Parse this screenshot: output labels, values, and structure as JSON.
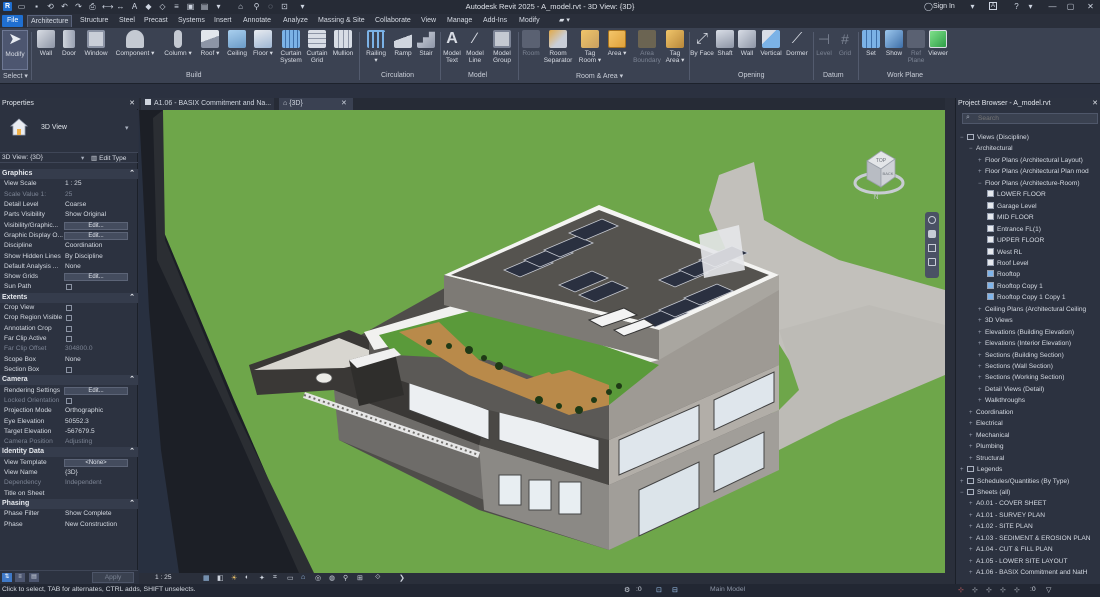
{
  "title_bar": {
    "title": "Autodesk Revit 2025 - A_model.rvt - 3D View: {3D}",
    "sign_in": "Sign In"
  },
  "ribbon_tabs": [
    "File",
    "Architecture",
    "Structure",
    "Steel",
    "Precast",
    "Systems",
    "Insert",
    "Annotate",
    "Analyze",
    "Massing & Site",
    "Collaborate",
    "View",
    "Manage",
    "Add-Ins",
    "Modify"
  ],
  "ribbon": {
    "buttons": [
      {
        "id": "modify",
        "label": "Modify"
      },
      {
        "id": "wall",
        "label": "Wall"
      },
      {
        "id": "door",
        "label": "Door"
      },
      {
        "id": "window",
        "label": "Window"
      },
      {
        "id": "component",
        "label": "Component"
      },
      {
        "id": "column",
        "label": "Column"
      },
      {
        "id": "roof",
        "label": "Roof"
      },
      {
        "id": "ceiling",
        "label": "Ceiling"
      },
      {
        "id": "floor",
        "label": "Floor"
      },
      {
        "id": "curtain-system",
        "label": "Curtain System"
      },
      {
        "id": "curtain-grid",
        "label": "Curtain Grid"
      },
      {
        "id": "mullion",
        "label": "Mullion"
      },
      {
        "id": "railing",
        "label": "Railing"
      },
      {
        "id": "ramp",
        "label": "Ramp"
      },
      {
        "id": "stair",
        "label": "Stair"
      },
      {
        "id": "model-text",
        "label": "Model Text"
      },
      {
        "id": "model-line",
        "label": "Model Line"
      },
      {
        "id": "model-group",
        "label": "Model Group"
      },
      {
        "id": "room",
        "label": "Room"
      },
      {
        "id": "room-separator",
        "label": "Room Separator"
      },
      {
        "id": "tag-room",
        "label": "Tag Room"
      },
      {
        "id": "area",
        "label": "Area"
      },
      {
        "id": "area-boundary",
        "label": "Area Boundary"
      },
      {
        "id": "tag-area",
        "label": "Tag Area"
      },
      {
        "id": "by-face",
        "label": "By Face"
      },
      {
        "id": "shaft",
        "label": "Shaft"
      },
      {
        "id": "opening-wall",
        "label": "Wall"
      },
      {
        "id": "vertical",
        "label": "Vertical"
      },
      {
        "id": "dormer",
        "label": "Dormer"
      },
      {
        "id": "level",
        "label": "Level"
      },
      {
        "id": "grid",
        "label": "Grid"
      },
      {
        "id": "set",
        "label": "Set"
      },
      {
        "id": "show",
        "label": "Show"
      },
      {
        "id": "ref-plane",
        "label": "Ref Plane"
      },
      {
        "id": "viewer",
        "label": "Viewer"
      }
    ],
    "groups": [
      "Select",
      "Build",
      "Circulation",
      "Model",
      "Room & Area",
      "Opening",
      "Datum",
      "Work Plane"
    ]
  },
  "properties": {
    "header": "Properties",
    "type_name": "3D View",
    "selector": "3D View: {3D}",
    "edit_type": "Edit Type",
    "sections": [
      {
        "name": "Graphics",
        "rows": [
          {
            "k": "View Scale",
            "v": "1 : 25"
          },
          {
            "k": "Scale Value 1:",
            "v": "25",
            "dim": true
          },
          {
            "k": "Detail Level",
            "v": "Coarse"
          },
          {
            "k": "Parts Visibility",
            "v": "Show Original"
          },
          {
            "k": "Visibility/Graphic...",
            "btn": "Edit..."
          },
          {
            "k": "Graphic Display O...",
            "btn": "Edit..."
          },
          {
            "k": "Discipline",
            "v": "Coordination"
          },
          {
            "k": "Show Hidden Lines",
            "v": "By Discipline"
          },
          {
            "k": "Default Analysis ...",
            "v": "None"
          },
          {
            "k": "Show Grids",
            "btn": "Edit..."
          },
          {
            "k": "Sun Path",
            "chk": true
          }
        ]
      },
      {
        "name": "Extents",
        "rows": [
          {
            "k": "Crop View",
            "chk": true
          },
          {
            "k": "Crop Region Visible",
            "chk": true
          },
          {
            "k": "Annotation Crop",
            "chk": true
          },
          {
            "k": "Far Clip Active",
            "chk": true
          },
          {
            "k": "Far Clip Offset",
            "v": "304800.0",
            "dim": true
          },
          {
            "k": "Scope Box",
            "v": "None"
          },
          {
            "k": "Section Box",
            "chk": true
          }
        ]
      },
      {
        "name": "Camera",
        "rows": [
          {
            "k": "Rendering Settings",
            "btn": "Edit..."
          },
          {
            "k": "Locked Orientation",
            "chk": true,
            "dim": true
          },
          {
            "k": "Projection Mode",
            "v": "Orthographic"
          },
          {
            "k": "Eye Elevation",
            "v": "50552.3"
          },
          {
            "k": "Target Elevation",
            "v": "-567679.5"
          },
          {
            "k": "Camera Position",
            "v": "Adjusting",
            "dim": true
          }
        ]
      },
      {
        "name": "Identity Data",
        "rows": [
          {
            "k": "View Template",
            "btn": "<None>"
          },
          {
            "k": "View Name",
            "v": "{3D}"
          },
          {
            "k": "Dependency",
            "v": "Independent",
            "dim": true
          },
          {
            "k": "Title on Sheet",
            "v": ""
          }
        ]
      },
      {
        "name": "Phasing",
        "rows": [
          {
            "k": "Phase Filter",
            "v": "Show Complete"
          },
          {
            "k": "Phase",
            "v": "New Construction"
          }
        ]
      }
    ],
    "apply": "Apply"
  },
  "view_tabs": [
    {
      "label": "A1.06 - BASIX Commitment and Na..."
    },
    {
      "label": "{3D}"
    }
  ],
  "project_browser": {
    "header": "Project Browser - A_model.rvt",
    "search_placeholder": "Search",
    "items": [
      {
        "label": "Views (Discipline)",
        "indent": 0,
        "tw": "−"
      },
      {
        "label": "Architectural",
        "indent": 1,
        "tw": "−"
      },
      {
        "label": "Floor Plans (Architectural Layout)",
        "indent": 2,
        "tw": "+"
      },
      {
        "label": "Floor Plans (Architectural Plan mod",
        "indent": 2,
        "tw": "+"
      },
      {
        "label": "Floor Plans (Architecture-Room)",
        "indent": 2,
        "tw": "−"
      },
      {
        "label": "LOWER FLOOR",
        "indent": 3,
        "view": true
      },
      {
        "label": "Garage Level",
        "indent": 3,
        "view": true
      },
      {
        "label": "MID FLOOR",
        "indent": 3,
        "view": true
      },
      {
        "label": "Entrance FL(1)",
        "indent": 3,
        "view": true
      },
      {
        "label": "UPPER FLOOR",
        "indent": 3,
        "view": true
      },
      {
        "label": "West RL",
        "indent": 3,
        "view": true
      },
      {
        "label": "Roof Level",
        "indent": 3,
        "view": true
      },
      {
        "label": "Rooftop",
        "indent": 3,
        "view": true,
        "blue": true
      },
      {
        "label": "Rooftop Copy 1",
        "indent": 3,
        "view": true,
        "blue": true
      },
      {
        "label": "Rooftop Copy 1 Copy 1",
        "indent": 3,
        "view": true,
        "blue": true
      },
      {
        "label": "Ceiling Plans (Architectural Ceiling",
        "indent": 2,
        "tw": "+"
      },
      {
        "label": "3D Views",
        "indent": 2,
        "tw": "+"
      },
      {
        "label": "Elevations (Building Elevation)",
        "indent": 2,
        "tw": "+"
      },
      {
        "label": "Elevations (Interior Elevation)",
        "indent": 2,
        "tw": "+"
      },
      {
        "label": "Sections (Building Section)",
        "indent": 2,
        "tw": "+"
      },
      {
        "label": "Sections (Wall Section)",
        "indent": 2,
        "tw": "+"
      },
      {
        "label": "Sections (Working Section)",
        "indent": 2,
        "tw": "+"
      },
      {
        "label": "Detail Views (Detail)",
        "indent": 2,
        "tw": "+"
      },
      {
        "label": "Walkthroughs",
        "indent": 2,
        "tw": "+"
      },
      {
        "label": "Coordination",
        "indent": 1,
        "tw": "+"
      },
      {
        "label": "Electrical",
        "indent": 1,
        "tw": "+"
      },
      {
        "label": "Mechanical",
        "indent": 1,
        "tw": "+"
      },
      {
        "label": "Plumbing",
        "indent": 1,
        "tw": "+"
      },
      {
        "label": "Structural",
        "indent": 1,
        "tw": "+"
      },
      {
        "label": "Legends",
        "indent": 0,
        "tw": "+"
      },
      {
        "label": "Schedules/Quantities (By Type)",
        "indent": 0,
        "tw": "+"
      },
      {
        "label": "Sheets (all)",
        "indent": 0,
        "tw": "−"
      },
      {
        "label": "A0.01 - COVER SHEET",
        "indent": 1,
        "tw": "+"
      },
      {
        "label": "A1.01 - SURVEY PLAN",
        "indent": 1,
        "tw": "+"
      },
      {
        "label": "A1.02 - SITE PLAN",
        "indent": 1,
        "tw": "+"
      },
      {
        "label": "A1.03 - SEDIMENT & EROSION PLAN",
        "indent": 1,
        "tw": "+"
      },
      {
        "label": "A1.04 - CUT & FILL PLAN",
        "indent": 1,
        "tw": "+"
      },
      {
        "label": "A1.05 - LOWER SITE LAYOUT",
        "indent": 1,
        "tw": "+"
      },
      {
        "label": "A1.06 - BASIX Commitment and NatH",
        "indent": 1,
        "tw": "+"
      }
    ]
  },
  "view_control": {
    "scale": "1 : 25"
  },
  "status": {
    "message": "Click to select, TAB for alternates, CTRL adds, SHIFT unselects.",
    "zero": ":0",
    "model": "Main Model"
  },
  "view_cube": {
    "top": "TOP",
    "back": "BACK",
    "compass": "N"
  }
}
